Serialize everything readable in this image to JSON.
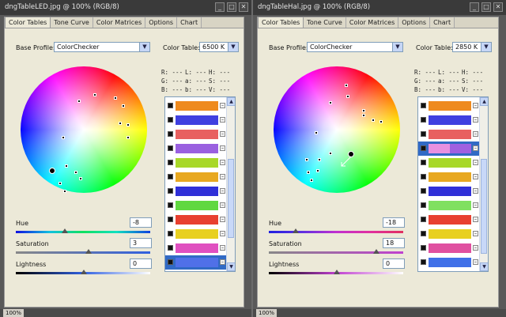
{
  "windows": [
    {
      "title": "dngTableLED.jpg @ 100% (RGB/8)",
      "tabs": [
        "Color Tables",
        "Tone Curve",
        "Color Matrices",
        "Options",
        "Chart"
      ],
      "base_profile_label": "Base Profile:",
      "base_profile_value": "ColorChecker",
      "color_table_label": "Color Table:",
      "color_table_value": "6500 K",
      "readout": {
        "r": "R:  ---",
        "l": "L:  ---",
        "h": "H:  ---",
        "g": "G:  ---",
        "a": "a:  ---",
        "s": "S:  ---",
        "b": "B:  ---",
        "b2": "b:  ---",
        "v": "V:  ---"
      },
      "swatches": [
        {
          "a": "#ee8a1e",
          "b": "#ee8a1e"
        },
        {
          "a": "#4040e0",
          "b": "#4040e0"
        },
        {
          "a": "#e86060",
          "b": "#e86060"
        },
        {
          "a": "#9a60e0",
          "b": "#9a60e0"
        },
        {
          "a": "#a8d828",
          "b": "#a8d828"
        },
        {
          "a": "#e8a820",
          "b": "#e8a820"
        },
        {
          "a": "#3030d8",
          "b": "#3030d8"
        },
        {
          "a": "#60d840",
          "b": "#60d840"
        },
        {
          "a": "#e84030",
          "b": "#e84030"
        },
        {
          "a": "#e8d020",
          "b": "#e8d020"
        },
        {
          "a": "#e050c0",
          "b": "#e050c0"
        },
        {
          "a": "#5070e8",
          "b": "#5070e8"
        }
      ],
      "selected_index": 11,
      "hue_label": "Hue",
      "hue_value": "-8",
      "saturation_label": "Saturation",
      "saturation_value": "3",
      "lightness_label": "Lightness",
      "lightness_value": "0",
      "zoom": "100%"
    },
    {
      "title": "dngTableHal.jpg @ 100% (RGB/8)",
      "tabs": [
        "Color Tables",
        "Tone Curve",
        "Color Matrices",
        "Options",
        "Chart"
      ],
      "base_profile_label": "Base Profile:",
      "base_profile_value": "ColorChecker",
      "color_table_label": "Color Table:",
      "color_table_value": "2850 K",
      "readout": {
        "r": "R:  ---",
        "l": "L:  ---",
        "h": "H:  ---",
        "g": "G:  ---",
        "a": "a:  ---",
        "s": "S:  ---",
        "b": "B:  ---",
        "b2": "b:  ---",
        "v": "V:  ---"
      },
      "swatches": [
        {
          "a": "#ee8a1e",
          "b": "#ee8a1e"
        },
        {
          "a": "#4040e0",
          "b": "#4040e0"
        },
        {
          "a": "#e86060",
          "b": "#e86060"
        },
        {
          "a": "#e890e0",
          "b": "#a060e0"
        },
        {
          "a": "#a8d828",
          "b": "#a8d828"
        },
        {
          "a": "#e8a820",
          "b": "#e8a820"
        },
        {
          "a": "#3030d8",
          "b": "#3030d8"
        },
        {
          "a": "#80e060",
          "b": "#80e060"
        },
        {
          "a": "#e84030",
          "b": "#e84030"
        },
        {
          "a": "#e8d020",
          "b": "#e8d020"
        },
        {
          "a": "#e050a0",
          "b": "#e050a0"
        },
        {
          "a": "#4070e8",
          "b": "#4070e8"
        }
      ],
      "selected_index": 3,
      "hue_label": "Hue",
      "hue_value": "-18",
      "saturation_label": "Saturation",
      "saturation_value": "18",
      "lightness_label": "Lightness",
      "lightness_value": "0",
      "zoom": "100%"
    }
  ]
}
